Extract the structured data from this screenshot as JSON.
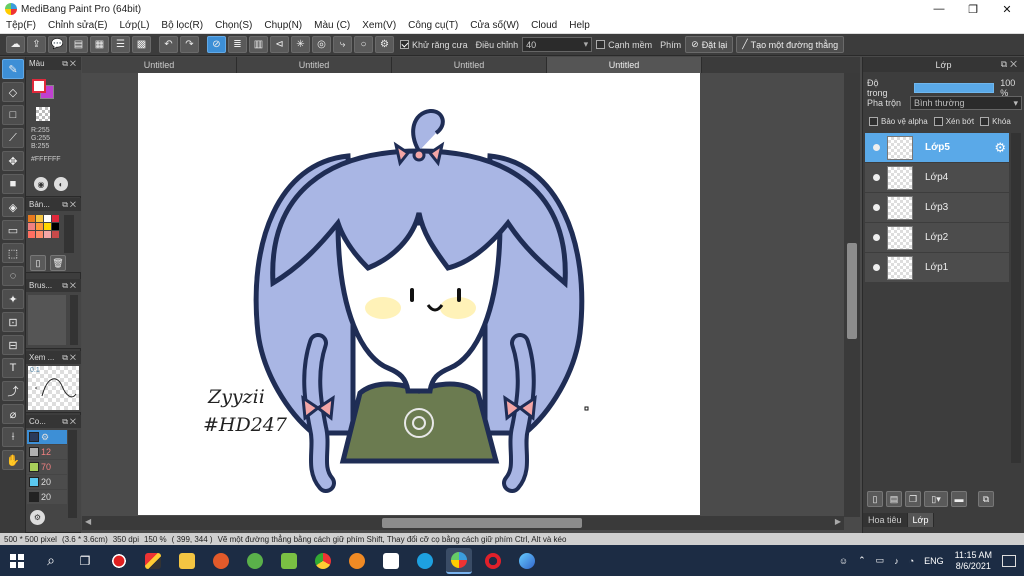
{
  "window": {
    "title": "MediBang Paint Pro (64bit)",
    "controls": {
      "minimize": "—",
      "maximize": "❐",
      "close": "✕"
    }
  },
  "menu": [
    "Tệp(F)",
    "Chỉnh sửa(E)",
    "Lớp(L)",
    "Bộ lọc(R)",
    "Chọn(S)",
    "Chụp(N)",
    "Màu (C)",
    "Xem(V)",
    "Công cụ(T)",
    "Cửa số(W)",
    "Cloud",
    "Help"
  ],
  "toolbar": {
    "antialias_label": "Khử răng cưa",
    "antialias_checked": true,
    "adjust_label": "Điều chỉnh",
    "adjust_value": "40",
    "snap_edge_label": "Cạnh mềm",
    "snap_edge_checked": false,
    "key_label": "Phím",
    "reset_label": "Đặt lại",
    "make_line_label": "Tạo một đường thẳng"
  },
  "panels": {
    "color": {
      "title": "Màu",
      "r": "R:255",
      "g": "G:255",
      "b": "B:255",
      "hex": "#FFFFFF",
      "fg": "#ffffff",
      "bg": "#c040d0"
    },
    "palette": {
      "title": "Bản...",
      "colors": [
        "#e87a1e",
        "#f4c542",
        "#ffffff",
        "#e0283b",
        "#f08080",
        "#ff9a3c",
        "#ffd700",
        "#000000",
        "#ff6f61",
        "#ff8c69",
        "#f4a6a6",
        "#c94a4a"
      ]
    },
    "brush": {
      "title": "Brus..."
    },
    "navigator": {
      "title": "Xem ...",
      "value": "0.1"
    },
    "colorset": {
      "title": "Co...",
      "rows": [
        {
          "color": "#2a3a5a",
          "value": ""
        },
        {
          "color": "#b0b0b0",
          "value": "12"
        },
        {
          "color": "#a8d05a",
          "value": "70"
        },
        {
          "color": "#5ac8f0",
          "value": "20"
        },
        {
          "color": "#222222",
          "value": "20"
        }
      ]
    }
  },
  "tabs": [
    {
      "label": "Untitled",
      "active": false
    },
    {
      "label": "Untitled",
      "active": false
    },
    {
      "label": "Untitled",
      "active": false
    },
    {
      "label": "Untitled",
      "active": true
    }
  ],
  "canvas": {
    "signature_line1": "Zyyzii",
    "signature_line2": "#HD247"
  },
  "layer_panel": {
    "title": "Lớp",
    "opacity_label": "Độ trong",
    "opacity_value": "100 %",
    "opacity_fraction": 1.0,
    "blend_label": "Pha trộn",
    "blend_value": "Bình thường",
    "protect_alpha": "Bảo vệ alpha",
    "clipping": "Xén bớt",
    "lock": "Khóa",
    "layers": [
      {
        "name": "Lớp5",
        "active": true
      },
      {
        "name": "Lớp4",
        "active": false
      },
      {
        "name": "Lớp3",
        "active": false
      },
      {
        "name": "Lớp2",
        "active": false
      },
      {
        "name": "Lớp1",
        "active": false
      }
    ],
    "tab_materials": "Hoa tiêu",
    "tab_layers": "Lớp"
  },
  "status": {
    "size": "500 * 500 pixel",
    "cm": "(3.6 * 3.6cm)",
    "dpi": "350 dpi",
    "zoom": "150 %",
    "cursor": "( 399, 344 )",
    "hint": "Vẽ một đường thẳng bằng cách giữ phím Shift, Thay đổi cỡ cọ bằng cách giữ phím Ctrl, Alt và kéo"
  },
  "taskbar": {
    "language": "ENG",
    "time": "11:15 AM",
    "date": "8/6/2021"
  }
}
